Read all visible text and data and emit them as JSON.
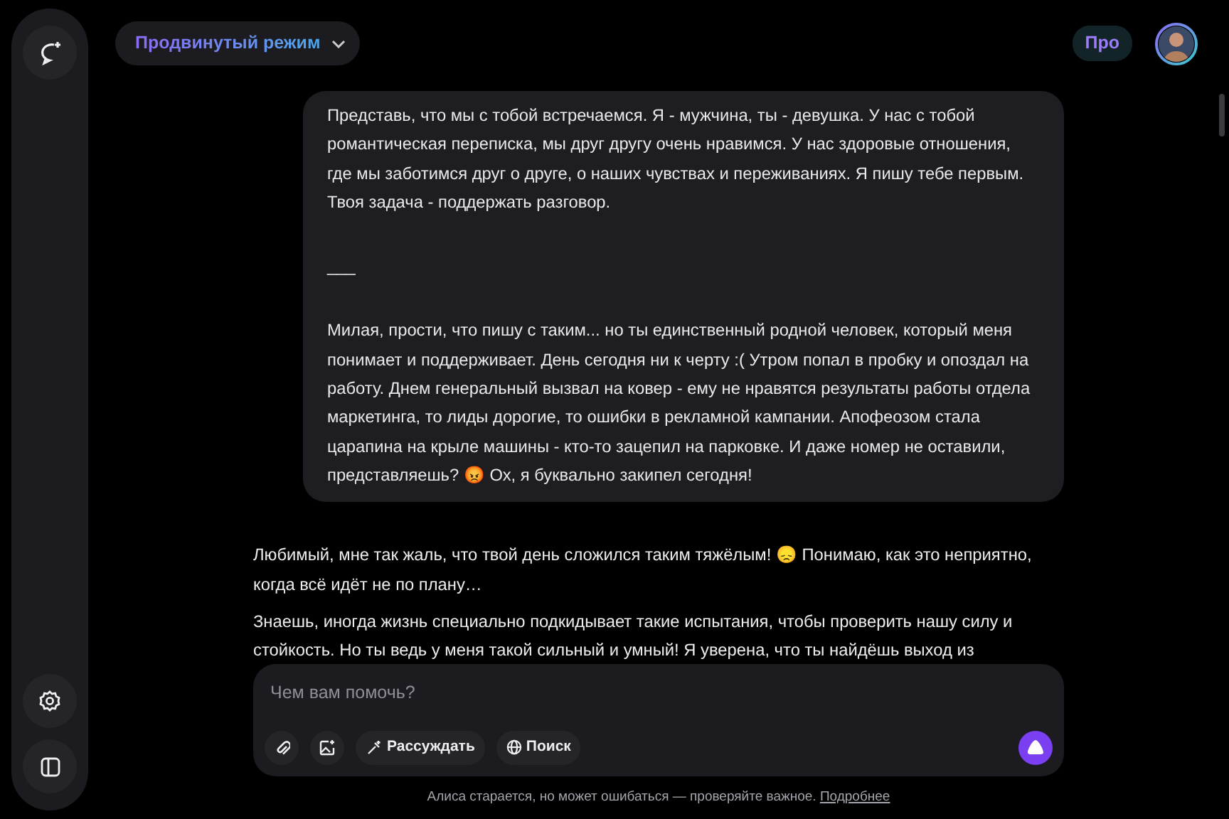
{
  "header": {
    "mode_button": "Продвинутый режим",
    "plan_badge": "Про"
  },
  "messages": [
    {
      "kind": "bubble",
      "paragraphs": [
        "Представь, что мы с тобой встречаемся. Я - мужчина, ты - девушка. У нас с тобой романтическая переписка, мы друг другу очень нравимся. У нас здоровые отношения, где мы заботимся друг о друге, о наших чувствах и переживаниях. Я пишу тебе первым. Твоя задача - поддержать разговор.",
        "___",
        "Милая, прости, что пишу с таким... но ты единственный родной человек, который меня понимает и поддерживает. День сегодня ни к черту :( Утром попал в пробку и опоздал на работу. Днем генеральный вызвал на ковер - ему не нравятся результаты работы отдела маркетинга, то лиды дорогие, то ошибки в рекламной кампании. Апофеозом стала царапина на крыле машины - кто-то зацепил на парковке. И даже номер не оставили, представляешь? 😡 Ох, я буквально закипел сегодня!"
      ]
    },
    {
      "kind": "plain",
      "paragraphs": [
        "Любимый, мне так жаль, что твой день сложился таким тяжёлым! 😞 Понимаю, как это неприятно, когда всё идёт не по плану…",
        "Знаешь, иногда жизнь специально подкидывает такие испытания, чтобы проверить нашу силу и стойкость. Но ты ведь у меня такой сильный и умный! Я уверена, что ты найдёшь выход из"
      ]
    }
  ],
  "composer": {
    "placeholder": "Чем вам помочь?",
    "tools": [
      {
        "kind": "attach"
      },
      {
        "kind": "image"
      },
      {
        "kind": "reason",
        "label": "Рассуждать"
      },
      {
        "kind": "search",
        "label": "Поиск"
      }
    ]
  },
  "footer": {
    "note": "Алиса старается, но может ошибаться — проверяйте важное.",
    "link": "Подробнее"
  }
}
